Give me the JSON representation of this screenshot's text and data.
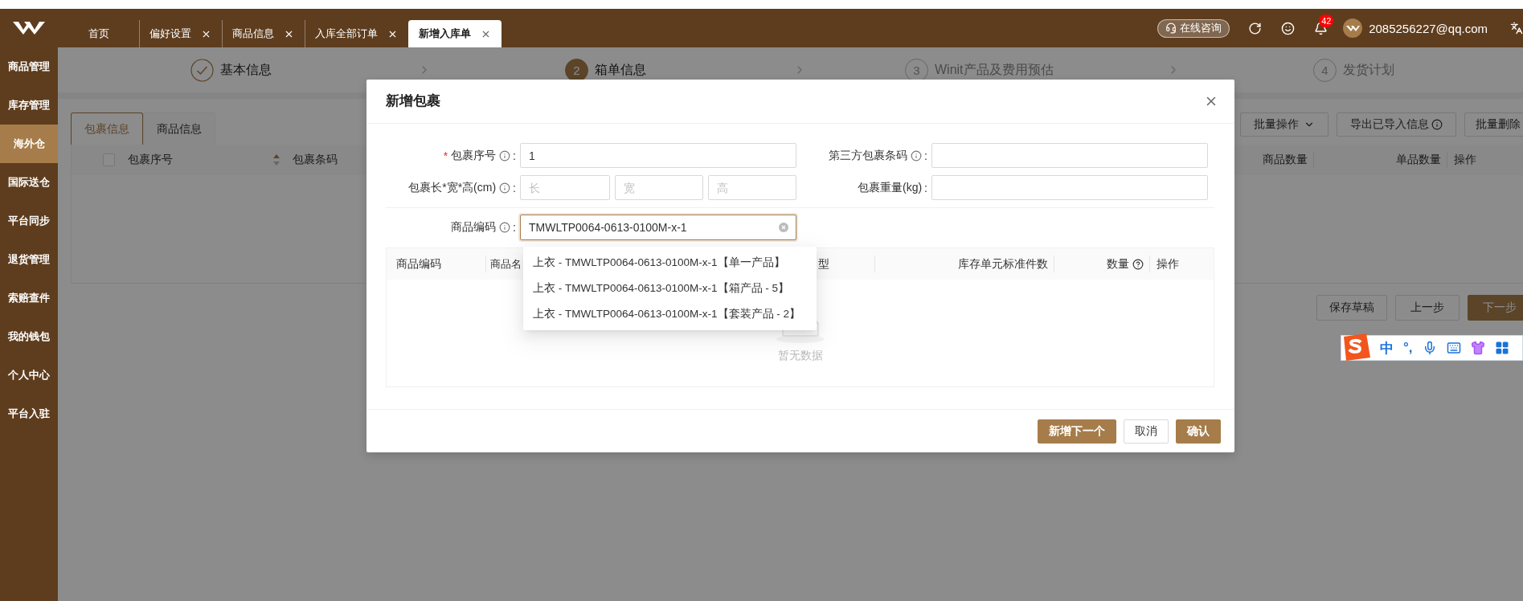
{
  "top_tabs": [
    {
      "label": "首页",
      "closable": false,
      "selected": false
    },
    {
      "label": "偏好设置",
      "closable": true,
      "selected": false
    },
    {
      "label": "商品信息",
      "closable": true,
      "selected": false
    },
    {
      "label": "入库全部订单",
      "closable": true,
      "selected": false
    },
    {
      "label": "新增入库单",
      "closable": true,
      "selected": true
    }
  ],
  "header": {
    "consult_label": "在线咨询",
    "notification_count": "42",
    "user_email": "2085256227@qq.com"
  },
  "sidebar": {
    "items": [
      {
        "label": "商品管理",
        "selected": false
      },
      {
        "label": "库存管理",
        "selected": false
      },
      {
        "label": "海外仓",
        "selected": true
      },
      {
        "label": "国际送仓",
        "selected": false
      },
      {
        "label": "平台同步",
        "selected": false
      },
      {
        "label": "退货管理",
        "selected": false
      },
      {
        "label": "索赔查件",
        "selected": false
      },
      {
        "label": "我的钱包",
        "selected": false
      },
      {
        "label": "个人中心",
        "selected": false
      },
      {
        "label": "平台入驻",
        "selected": false
      }
    ]
  },
  "steps": [
    {
      "label": "基本信息",
      "completed": true,
      "active": false
    },
    {
      "number": "2",
      "label": "箱单信息",
      "completed": false,
      "active": true
    },
    {
      "number": "3",
      "label": "Winit产品及费用预估",
      "completed": false,
      "active": false
    },
    {
      "number": "4",
      "label": "发货计划",
      "completed": false,
      "active": false
    }
  ],
  "content_tabs": [
    {
      "label": "包裹信息",
      "selected": true
    },
    {
      "label": "商品信息",
      "selected": false
    }
  ],
  "toolbar_buttons": [
    {
      "label": "批量操作",
      "kind": "dropdown"
    },
    {
      "label": "导出已导入信息",
      "kind": "info"
    },
    {
      "label": "批量删除",
      "kind": "plain"
    }
  ],
  "package_table": {
    "select_all": {
      "checked": false
    },
    "columns": [
      {
        "label": "包裹序号",
        "sortable": true
      },
      {
        "label": "包裹条码",
        "sortable": false
      },
      {
        "label": "商品数量",
        "sortable": false
      },
      {
        "label": "单品数量",
        "sortable": false
      },
      {
        "label": "操作",
        "sortable": false
      }
    ]
  },
  "footer_buttons": [
    {
      "label": "保存草稿",
      "primary": false
    },
    {
      "label": "上一步",
      "primary": false
    },
    {
      "label": "下一步",
      "primary": true
    }
  ],
  "ime_toolbar": {
    "mode": "中",
    "punctuation": "°,"
  },
  "dialog": {
    "title": "新增包裹",
    "rows": [
      {
        "fields": [
          {
            "kind": "text",
            "required_mark": "*",
            "label": "包裹序号",
            "info": true,
            "colon": ":",
            "value": "1",
            "focused": false
          },
          {
            "kind": "text",
            "label": "第三方包裹条码",
            "info": true,
            "colon": ":",
            "focused": false
          }
        ]
      },
      {
        "fields": [
          {
            "kind": "dimensions",
            "label": "包裹长*宽*高(cm)",
            "info": true,
            "colon": ":",
            "inputs": [
              {
                "placeholder": "长"
              },
              {
                "placeholder": "宽"
              },
              {
                "placeholder": "高"
              }
            ]
          },
          {
            "kind": "text",
            "label": "包裹重量(kg)",
            "info": false,
            "colon": ":",
            "focused": false
          }
        ]
      },
      {
        "fields": [
          {
            "kind": "search",
            "label": "商品编码",
            "info": true,
            "colon": ":",
            "value": "TMWLTP0064-0613-0100M-x-1",
            "focused": true
          }
        ]
      }
    ],
    "items_table": {
      "columns": [
        {
          "label": "商品编码"
        },
        {
          "label": "商品名"
        },
        {
          "label": "型"
        },
        {
          "label": "库存单元标准件数"
        },
        {
          "label": "数量",
          "help": true
        },
        {
          "label": "操作"
        }
      ],
      "empty_text": "暂无数据"
    },
    "suggestions": [
      "上衣 - TMWLTP0064-0613-0100M-x-1【单一产品】",
      "上衣 - TMWLTP0064-0613-0100M-x-1【箱产品 - 5】",
      "上衣 - TMWLTP0064-0613-0100M-x-1【套装产品 - 2】"
    ],
    "buttons": [
      {
        "label": "新增下一个",
        "primary": true
      },
      {
        "label": "取消",
        "primary": false
      },
      {
        "label": "确认",
        "primary": true
      }
    ]
  }
}
